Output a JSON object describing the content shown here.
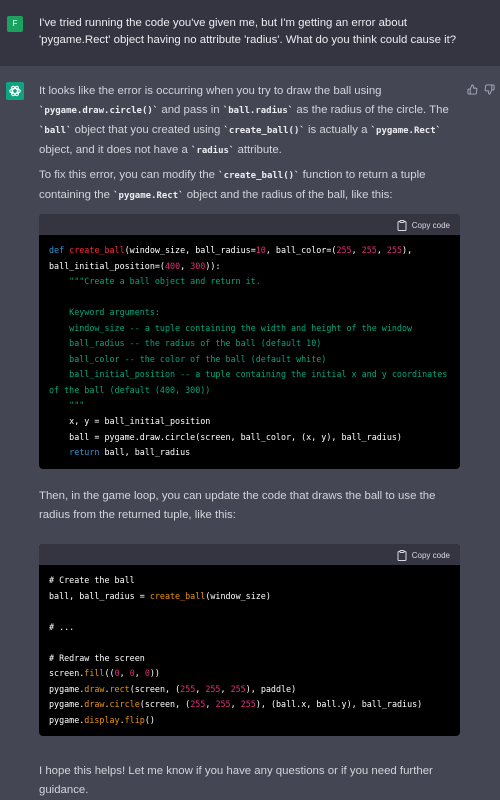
{
  "user": {
    "avatar_letter": "F",
    "message": "I've tried running the code you've given me, but I'm getting an error about 'pygame.Rect' object having no attribute 'radius'. What do you think could cause it?"
  },
  "assistant": {
    "p1": {
      "a": "It looks like the error is occurring when you try to draw the ball using ",
      "c1": "`pygame.draw.circle()`",
      "b": " and pass in ",
      "c2": "`ball.radius`",
      "c": " as the radius of the circle. The ",
      "c3": "`ball`",
      "d": " object that you created using ",
      "c4": "`create_ball()`",
      "e": " is actually a ",
      "c5": "`pygame.Rect`",
      "f": " object, and it does not have a ",
      "c6": "`radius`",
      "g": " attribute."
    },
    "p2": {
      "a": "To fix this error, you can modify the ",
      "c1": "`create_ball()`",
      "b": " function to return a tuple containing the ",
      "c2": "`pygame.Rect`",
      "c": " object and the radius of the ball, like this:"
    },
    "p3": "Then, in the game loop, you can update the code that draws the ball to use the radius from the returned tuple, like this:",
    "p4": "I hope this helps! Let me know if you have any questions or if you need further guidance.",
    "copy_label": "Copy code",
    "code1": [
      [
        [
          "kw",
          "def "
        ],
        [
          "fn",
          "create_ball"
        ],
        [
          "",
          "(window_size, ball_radius="
        ],
        [
          "num",
          "10"
        ],
        [
          "",
          ", ball_color=("
        ],
        [
          "num",
          "255"
        ],
        [
          "",
          ", "
        ],
        [
          "num",
          "255"
        ],
        [
          "",
          ", "
        ],
        [
          "num",
          "255"
        ],
        [
          "",
          "),"
        ]
      ],
      [
        [
          "",
          "ball_initial_position=("
        ],
        [
          "num",
          "400"
        ],
        [
          "",
          ", "
        ],
        [
          "num",
          "300"
        ],
        [
          "",
          "))"
        ],
        [
          "",
          ":"
        ]
      ],
      [
        [
          "str",
          "    \"\"\"Create a ball object and return it."
        ]
      ],
      [
        [
          "str",
          ""
        ]
      ],
      [
        [
          "str",
          "    Keyword arguments:"
        ]
      ],
      [
        [
          "str",
          "    window_size -- a tuple containing the width and height of the window"
        ]
      ],
      [
        [
          "str",
          "    ball_radius -- the radius of the ball (default 10)"
        ]
      ],
      [
        [
          "str",
          "    ball_color -- the color of the ball (default white)"
        ]
      ],
      [
        [
          "str",
          "    ball_initial_position -- a tuple containing the initial x and y coordinates"
        ]
      ],
      [
        [
          "str",
          "of the ball (default (400, 300))"
        ]
      ],
      [
        [
          "str",
          "    \"\"\""
        ]
      ],
      [
        [
          "",
          "    x, y = ball_initial_position"
        ]
      ],
      [
        [
          "",
          "    ball = pygame.draw.circle(screen, ball_color, (x, y), ball_radius)"
        ]
      ],
      [
        [
          "kw",
          "    return"
        ],
        [
          "",
          " ball, ball_radius"
        ]
      ]
    ],
    "code2": [
      [
        [
          "cm",
          "# Create the ball"
        ]
      ],
      [
        [
          "",
          "ball, ball_radius = "
        ],
        [
          "attr",
          "create_ball"
        ],
        [
          "",
          "(window_size)"
        ]
      ],
      [
        [
          "",
          ""
        ]
      ],
      [
        [
          "cm",
          "# ..."
        ]
      ],
      [
        [
          "",
          ""
        ]
      ],
      [
        [
          "cm",
          "# Redraw the screen"
        ]
      ],
      [
        [
          "",
          "screen."
        ],
        [
          "attr",
          "fill"
        ],
        [
          "",
          "(("
        ],
        [
          "num",
          "0"
        ],
        [
          "",
          ", "
        ],
        [
          "num",
          "0"
        ],
        [
          "",
          ", "
        ],
        [
          "num",
          "0"
        ],
        [
          "",
          "))"
        ]
      ],
      [
        [
          "",
          "pygame."
        ],
        [
          "attr",
          "draw"
        ],
        [
          "",
          "."
        ],
        [
          "attr",
          "rect"
        ],
        [
          "",
          "(screen, ("
        ],
        [
          "num",
          "255"
        ],
        [
          "",
          ", "
        ],
        [
          "num",
          "255"
        ],
        [
          "",
          ", "
        ],
        [
          "num",
          "255"
        ],
        [
          "",
          "), paddle)"
        ]
      ],
      [
        [
          "",
          "pygame."
        ],
        [
          "attr",
          "draw"
        ],
        [
          "",
          "."
        ],
        [
          "attr",
          "circle"
        ],
        [
          "",
          "(screen, ("
        ],
        [
          "num",
          "255"
        ],
        [
          "",
          ", "
        ],
        [
          "num",
          "255"
        ],
        [
          "",
          ", "
        ],
        [
          "num",
          "255"
        ],
        [
          "",
          "), (ball.x, ball.y), ball_radius)"
        ]
      ],
      [
        [
          "",
          "pygame."
        ],
        [
          "attr",
          "display"
        ],
        [
          "",
          "."
        ],
        [
          "attr",
          "flip"
        ],
        [
          "",
          "()"
        ]
      ]
    ]
  },
  "colors": {
    "user_bg": "#343541",
    "assistant_bg": "#444654",
    "user_avatar": "#1aa260",
    "bot_avatar": "#10a37f",
    "keyword": "#2e95d3",
    "string": "#00a67d",
    "number": "#df3079",
    "function": "#f22c3d",
    "attribute": "#e9950c"
  },
  "icons": [
    "openai-logo-icon",
    "thumbs-up-icon",
    "thumbs-down-icon",
    "clipboard-icon"
  ]
}
